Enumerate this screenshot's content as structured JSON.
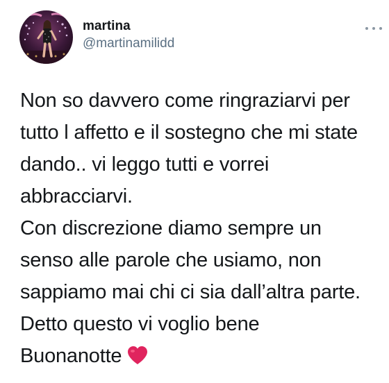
{
  "author": {
    "display_name": "martina",
    "handle": "@martinamilidd"
  },
  "menu": {
    "icon": "more-horizontal-icon"
  },
  "tweet": {
    "lines": [
      "Non so davvero come ringraziarvi per",
      "tutto l affetto e il sostegno che mi state",
      "dando.. vi leggo tutti e vorrei",
      "abbracciarvi.",
      "Con discrezione diamo sempre un",
      "senso alle parole che usiamo, non",
      "sappiamo mai chi ci sia dall’altra parte.",
      "Detto questo vi voglio bene",
      "Buonanotte"
    ],
    "emoji": "red-heart-icon"
  },
  "colors": {
    "text": "#14171a",
    "secondary": "#5b7083",
    "heart": "#e0245e"
  }
}
